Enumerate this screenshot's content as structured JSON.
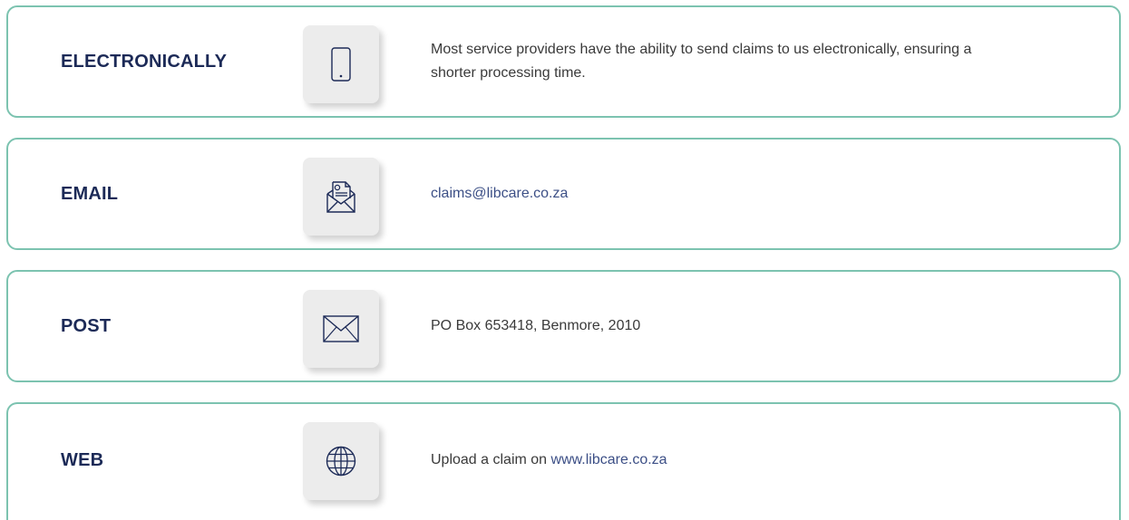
{
  "colors": {
    "border": "#7cc3b0",
    "label": "#1c2a57",
    "text": "#3a3a3a",
    "link": "#3c4f86",
    "icon_bg": "#ececec"
  },
  "methods": [
    {
      "label": "ELECTRONICALLY",
      "icon": "mobile-phone-icon",
      "description": "Most service providers have the ability to send claims to us electronically, ensuring a shorter processing time."
    },
    {
      "label": "EMAIL",
      "icon": "email-document-icon",
      "link": "claims@libcare.co.za"
    },
    {
      "label": "POST",
      "icon": "envelope-icon",
      "description": "PO Box 653418, Benmore, 2010"
    },
    {
      "label": "WEB",
      "icon": "globe-icon",
      "prefix": "Upload a claim on ",
      "link": "www.libcare.co.za"
    }
  ]
}
